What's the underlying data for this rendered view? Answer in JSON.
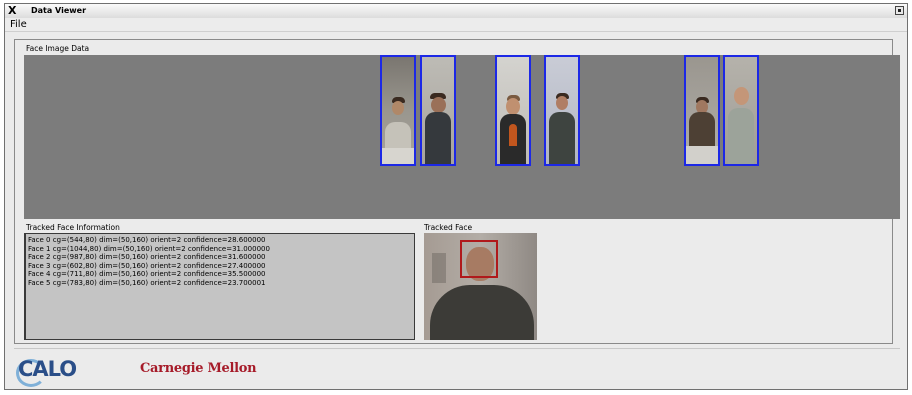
{
  "window": {
    "title": "Data Viewer",
    "xicon": "X"
  },
  "menu": {
    "file": "File"
  },
  "faces_panel": {
    "label": "Face Image Data",
    "box_color": "#1c28e6"
  },
  "info": {
    "label": "Tracked Face Information",
    "lines": [
      "Face 0 cg=(544,80) dim=(50,160) orient=2 confidence=28.600000",
      "Face 1 cg=(1044,80) dim=(50,160) orient=2 confidence=31.000000",
      "Face 2 cg=(987,80) dim=(50,160) orient=2 confidence=31.600000",
      "Face 3 cg=(602,80) dim=(50,160) orient=2 confidence=27.400000",
      "Face 4 cg=(711,80) dim=(50,160) orient=2 confidence=35.500000",
      "Face 5 cg=(783,80) dim=(50,160) orient=2 confidence=23.700001"
    ]
  },
  "tracked": {
    "label": "Tracked Face",
    "box_color": "#b0191b"
  },
  "footer": {
    "calo": "CALO",
    "cmu": "Carnegie Mellon"
  }
}
